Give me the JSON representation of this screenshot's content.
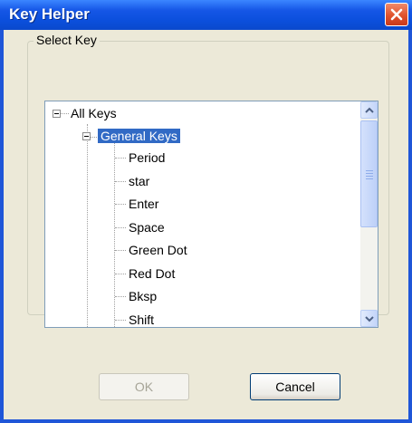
{
  "window": {
    "title": "Key Helper"
  },
  "group": {
    "label": "Select Key"
  },
  "tree": {
    "root": "All Keys",
    "parent": "General Keys",
    "items": [
      "Period",
      "star",
      "Enter",
      "Space",
      "Green Dot",
      "Red Dot",
      "Bksp",
      "Shift"
    ]
  },
  "buttons": {
    "ok": "OK",
    "cancel": "Cancel"
  },
  "colors": {
    "titlebar": "#0b4fdc",
    "selection": "#316ac5",
    "close": "#e0522c",
    "face": "#ece9d8"
  },
  "icons": {
    "close": "close-icon",
    "scroll_up": "chevron-up-icon",
    "scroll_down": "chevron-down-icon"
  }
}
